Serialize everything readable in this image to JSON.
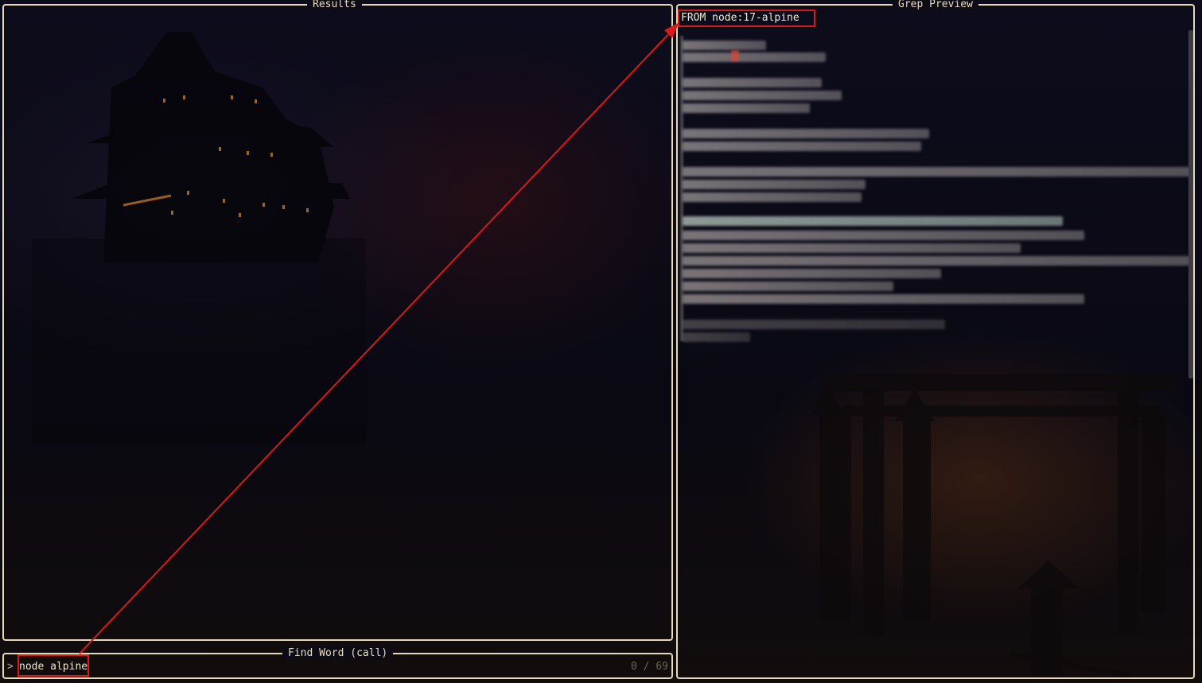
{
  "results_panel": {
    "title": "Results"
  },
  "find_panel": {
    "title": "Find Word (call)",
    "prompt": ">",
    "query": "node alpine",
    "counter": "0 / 69"
  },
  "preview_panel": {
    "title": "Grep Preview",
    "first_line": "FROM node:17-alpine"
  },
  "colors": {
    "border": "#e6d9b8",
    "highlight_box": "#d91a1a",
    "arrow": "#d91a1a"
  },
  "icons": [
    "arrow-annotation"
  ]
}
